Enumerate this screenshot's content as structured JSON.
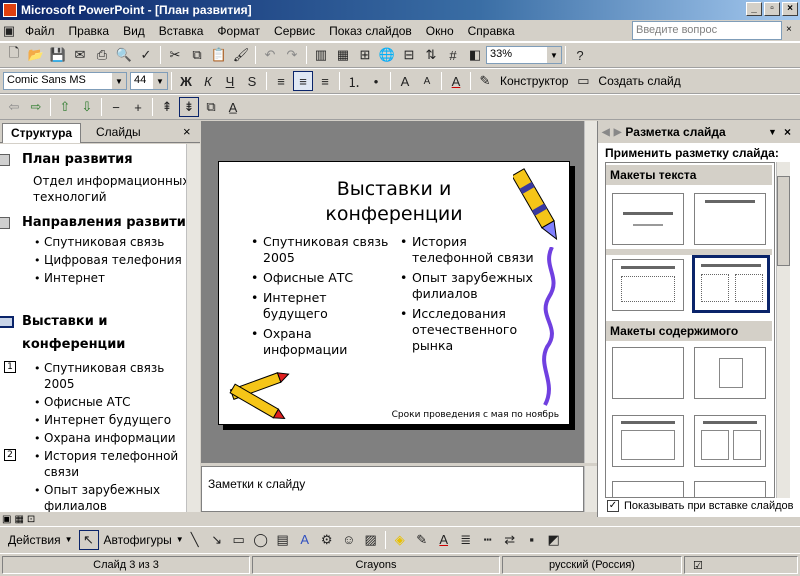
{
  "window": {
    "title": "Microsoft PowerPoint - [План развития]"
  },
  "menu": [
    "Файл",
    "Правка",
    "Вид",
    "Вставка",
    "Формат",
    "Сервис",
    "Показ слайдов",
    "Окно",
    "Справка"
  ],
  "ask_placeholder": "Введите вопрос",
  "toolbar": {
    "zoom": "33%",
    "font": "Comic Sans MS",
    "size": "44",
    "designer": "Конструктор",
    "new_slide": "Создать слайд"
  },
  "left_tabs": {
    "outline": "Структура",
    "slides": "Слайды"
  },
  "outline": [
    {
      "type": "title",
      "num": "",
      "text": "План развития"
    },
    {
      "type": "sub",
      "text": "Отдел информационных"
    },
    {
      "type": "sub",
      "text": "технологий"
    },
    {
      "type": "title",
      "num": "",
      "text": "Направления развития"
    },
    {
      "type": "bullet",
      "text": "Спутниковая связь"
    },
    {
      "type": "bullet",
      "text": "Цифровая телефония"
    },
    {
      "type": "bullet",
      "text": "Интернет"
    },
    {
      "type": "title",
      "num": "",
      "text": "Выставки и"
    },
    {
      "type": "title2",
      "text": "конференции"
    },
    {
      "type": "bullet",
      "num": "1",
      "text": "Спутниковая связь"
    },
    {
      "type": "bcont",
      "text": "2005"
    },
    {
      "type": "bullet",
      "text": "Офисные АТС"
    },
    {
      "type": "bullet",
      "text": "Интернет будущего"
    },
    {
      "type": "bullet",
      "text": "Охрана информации"
    },
    {
      "type": "bullet",
      "num": "2",
      "text": "История телефонной"
    },
    {
      "type": "bcont",
      "text": "связи"
    },
    {
      "type": "bullet",
      "text": "Опыт зарубежных"
    },
    {
      "type": "bcont",
      "text": "филиалов"
    }
  ],
  "slide": {
    "title_line1": "Выставки и",
    "title_line2": "конференции",
    "left": [
      [
        "Спутниковая связь",
        "2005"
      ],
      [
        "Офисные АТС"
      ],
      [
        "Интернет",
        "будущего"
      ],
      [
        "Охрана",
        "информации"
      ]
    ],
    "right": [
      [
        "История",
        "телефонной связи"
      ],
      [
        "Опыт зарубежных",
        "филиалов"
      ],
      [
        "Исследования",
        "отечественного",
        "рынка"
      ]
    ],
    "footer": "Сроки проведения с мая по ноябрь"
  },
  "notes": "Заметки к слайду",
  "taskpane": {
    "title": "Разметка слайда",
    "apply": "Применить разметку слайда:",
    "sec1": "Макеты текста",
    "sec2": "Макеты содержимого",
    "show_on_insert": "Показывать при вставке слайдов"
  },
  "drawbar": {
    "actions": "Действия",
    "autoshapes": "Автофигуры"
  },
  "status": {
    "slide": "Слайд 3 из 3",
    "design": "Crayons",
    "lang": "русский (Россия)"
  }
}
